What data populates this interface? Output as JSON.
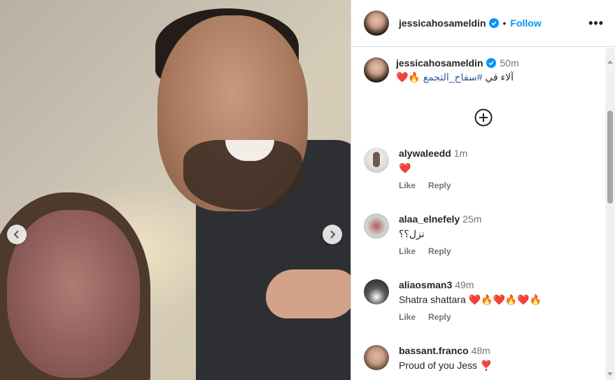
{
  "header": {
    "username": "jessicahosameldin",
    "separator": "•",
    "follow_label": "Follow",
    "more_label": "•••"
  },
  "caption": {
    "username": "jessicahosameldin",
    "time": "50m",
    "prefix": "آلاء في",
    "hashtag": "#سفاح_التجمع",
    "emojis": "🔥❤️"
  },
  "comments": [
    {
      "username": "alywaleedd",
      "time": "1m",
      "text": "❤️",
      "like": "Like",
      "reply": "Reply"
    },
    {
      "username": "alaa_elnefely",
      "time": "25m",
      "text": "نزل؟؟",
      "like": "Like",
      "reply": "Reply"
    },
    {
      "username": "aliaosman3",
      "time": "49m",
      "text": "Shatra shattara",
      "emojis": "❤️🔥❤️🔥❤️🔥",
      "like": "Like",
      "reply": "Reply"
    },
    {
      "username": "bassant.franco",
      "time": "48m",
      "text": "Proud of you Jess",
      "emojis": "❣️"
    }
  ],
  "colors": {
    "accent": "#0095f6",
    "border": "#dbdbdb",
    "muted": "#737373"
  },
  "icons": [
    "verified-badge-icon",
    "more-options-icon",
    "add-circle-icon",
    "chevron-left-icon",
    "chevron-right-icon"
  ]
}
